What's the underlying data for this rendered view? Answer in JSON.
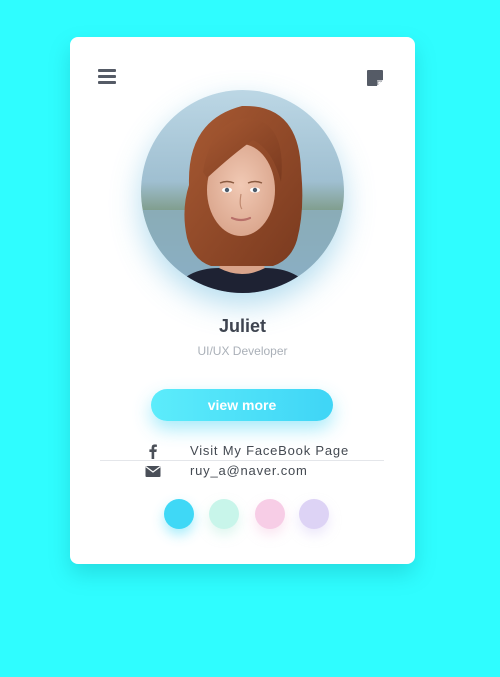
{
  "header": {
    "menu_icon": "hamburger-menu-icon",
    "note_icon": "sticky-note-icon"
  },
  "profile": {
    "name": "Juliet",
    "role": "UI/UX Developer",
    "avatar": "portrait-photo"
  },
  "actions": {
    "view_more_label": "view more"
  },
  "contacts": [
    {
      "icon": "facebook-icon",
      "text": "Visit My FaceBook Page"
    },
    {
      "icon": "envelope-icon",
      "text": "ruy_a@naver.com"
    }
  ],
  "color_dots": [
    {
      "color": "#3fd8f6",
      "name": "color-dot-cyan"
    },
    {
      "color": "#c8f5ea",
      "name": "color-dot-mint"
    },
    {
      "color": "#f7cde6",
      "name": "color-dot-pink"
    },
    {
      "color": "#ddd3f5",
      "name": "color-dot-lavender"
    }
  ],
  "colors": {
    "background": "#2ffdff",
    "accent": "#3fd5f6",
    "text_dark": "#3e4450",
    "text_muted": "#aab0b8"
  }
}
